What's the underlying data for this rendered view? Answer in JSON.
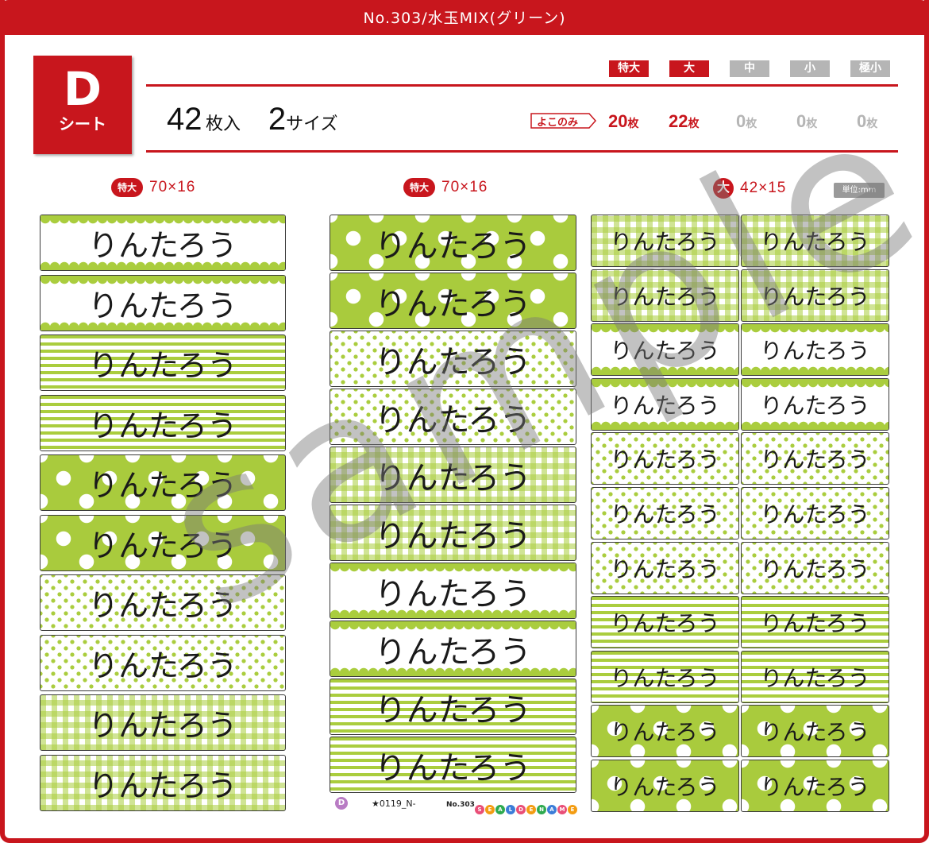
{
  "title": "No.303/水玉MIX(グリーン)",
  "sheet": {
    "letter": "D",
    "label": "シート"
  },
  "summary": {
    "count": "42",
    "count_unit": "枚入",
    "sizes": "2",
    "sizes_unit": "サイズ"
  },
  "size_buttons": [
    {
      "label": "特大",
      "color": "#c8161d"
    },
    {
      "label": "大",
      "color": "#c8161d"
    },
    {
      "label": "中",
      "color": "#b5b5b5"
    },
    {
      "label": "小",
      "color": "#b5b5b5"
    },
    {
      "label": "極小",
      "color": "#b5b5b5"
    }
  ],
  "yoko_label": "よこのみ",
  "size_counts": [
    {
      "n": "20",
      "u": "枚",
      "color": "#c8161d"
    },
    {
      "n": "22",
      "u": "枚",
      "color": "#c8161d"
    },
    {
      "n": "0",
      "u": "枚",
      "color": "#b5b5b5"
    },
    {
      "n": "0",
      "u": "枚",
      "color": "#b5b5b5"
    },
    {
      "n": "0",
      "u": "枚",
      "color": "#b5b5b5"
    }
  ],
  "columns": [
    {
      "size": "特大",
      "dim": "70×16"
    },
    {
      "size": "特大",
      "dim": "70×16"
    },
    {
      "size": "大",
      "dim": "42×15"
    }
  ],
  "unit_note": "単位:mm",
  "label_name": "りんたろう",
  "watermark": "sample",
  "footer": {
    "badge": "D",
    "code": "★0119_N-",
    "no": "No.303",
    "brand": "SEALDENAME"
  },
  "colors": {
    "accent": "#c8161d",
    "green": "#aacd3e"
  }
}
